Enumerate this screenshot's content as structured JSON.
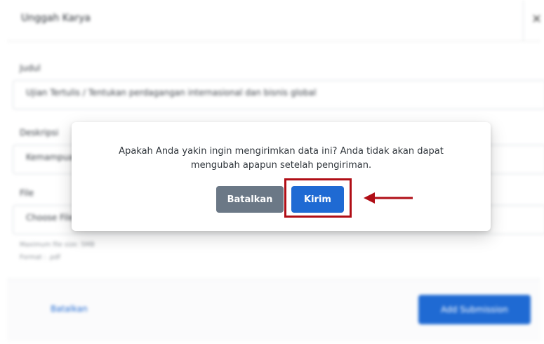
{
  "form": {
    "title": "Unggah Karya",
    "close_icon": "×",
    "judul_label": "Judul",
    "judul_value": "Ujian Tertulis / Tentukan perdagangan internasional dan bisnis global",
    "deskripsi_label": "Deskripsi",
    "deskripsi_value": "Kemampuan",
    "file_label": "File",
    "file_button": "Choose File",
    "file_hint_size": "Maximum file size: 5MB",
    "file_hint_format": "Format : .pdf",
    "cancel_link": "Batalkan",
    "submit_label": "Add Submission"
  },
  "modal": {
    "message_line1": "Apakah Anda yakin ingin mengirimkan data ini? Anda tidak akan dapat",
    "message_line2": "mengubah apapun setelah pengiriman.",
    "cancel_label": "Batalkan",
    "confirm_label": "Kirim"
  },
  "annotation": {
    "highlight_color": "#b00e16",
    "arrow_icon": "left-arrow"
  },
  "colors": {
    "primary": "#1f6ad3",
    "secondary": "#6b7886"
  }
}
